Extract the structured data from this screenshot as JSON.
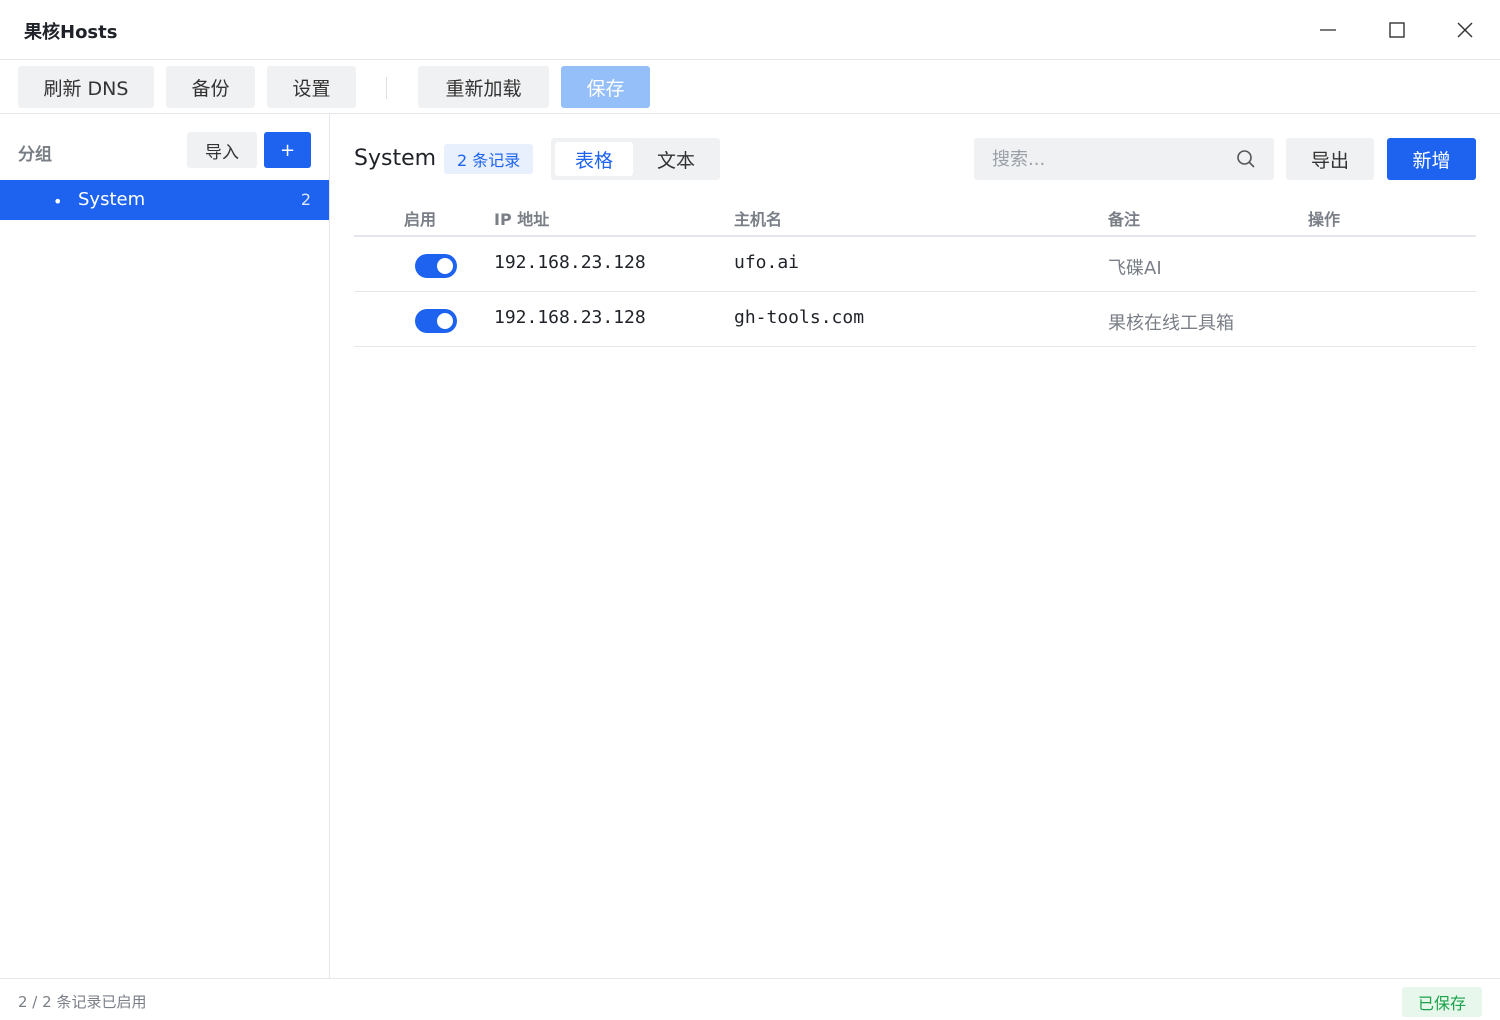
{
  "app": {
    "title": "果核Hosts"
  },
  "window_controls": {
    "minimize": "minimize-icon",
    "maximize": "maximize-icon",
    "close": "close-icon"
  },
  "toolbar": {
    "refresh_dns": "刷新 DNS",
    "backup": "备份",
    "settings": "设置",
    "reload": "重新加载",
    "save": "保存"
  },
  "sidebar": {
    "group_label": "分组",
    "import_label": "导入",
    "add_label": "+",
    "groups": [
      {
        "name": "System",
        "count": "2",
        "selected": true
      }
    ]
  },
  "main": {
    "title": "System",
    "record_badge": "2 条记录",
    "view_tabs": [
      {
        "label": "表格",
        "active": true
      },
      {
        "label": "文本",
        "active": false
      }
    ],
    "search": {
      "placeholder": "搜索...",
      "value": ""
    },
    "export_label": "导出",
    "new_label": "新增"
  },
  "table": {
    "columns": [
      "启用",
      "IP 地址",
      "主机名",
      "备注",
      "操作"
    ],
    "rows": [
      {
        "enabled": true,
        "ip": "192.168.23.128",
        "host": "ufo.ai",
        "note": "飞碟AI"
      },
      {
        "enabled": true,
        "ip": "192.168.23.128",
        "host": "gh-tools.com",
        "note": "果核在线工具箱"
      }
    ]
  },
  "status": {
    "summary": "2 / 2 条记录已启用",
    "saved": "已保存"
  },
  "colors": {
    "accent": "#1d63f0",
    "save_disabled": "#94bff9",
    "saved_green": "#1aa34a"
  }
}
